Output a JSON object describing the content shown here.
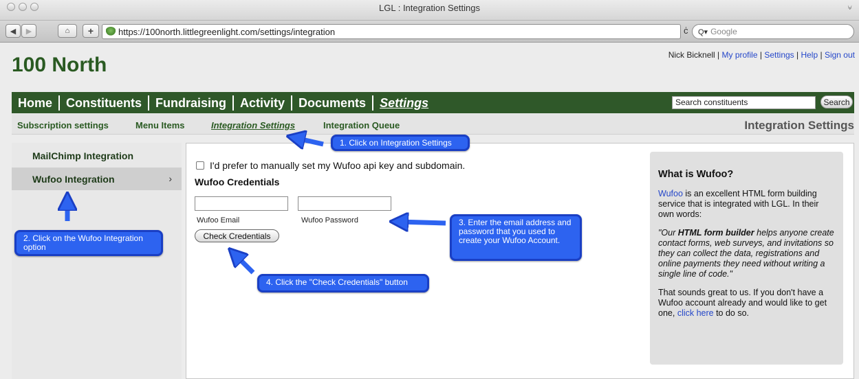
{
  "window": {
    "title": "LGL : Integration Settings"
  },
  "toolbar": {
    "back_icon": "left-triangle",
    "forward_icon": "right-triangle",
    "home_icon": "house",
    "add_icon": "plus",
    "url": "https://100north.littlegreenlight.com/settings/integration",
    "reload": "ċ",
    "search_placeholder": "Google",
    "search_icon": "Q▾"
  },
  "header": {
    "brand": "100 North",
    "user_name": "Nick Bicknell",
    "links": [
      "My profile",
      "Settings",
      "Help",
      "Sign out"
    ]
  },
  "mainnav": {
    "items": [
      "Home",
      "Constituents",
      "Fundraising",
      "Activity",
      "Documents",
      "Settings"
    ],
    "active": "Settings",
    "search_value": "Search constituents",
    "search_button": "Search"
  },
  "subnav": {
    "items": [
      "Subscription settings",
      "Menu Items",
      "Integration Settings",
      "Integration Queue"
    ],
    "active": "Integration Settings",
    "page_heading": "Integration Settings"
  },
  "sidebar": {
    "items": [
      "MailChimp Integration",
      "Wufoo Integration"
    ],
    "active": "Wufoo Integration",
    "chevron": "›"
  },
  "form": {
    "manual_checkbox_label": "I'd prefer to manually set my Wufoo api key and subdomain.",
    "manual_checked": false,
    "credentials_title": "Wufoo Credentials",
    "email_label": "Wufoo Email",
    "password_label": "Wufoo Password",
    "email_value": "",
    "password_value": "",
    "check_button": "Check Credentials"
  },
  "info": {
    "title": "What is Wufoo?",
    "p1_link": "Wufoo",
    "p1_text": " is an excellent HTML form building service that is integrated with LGL. In their own words:",
    "quote_pre": "\"Our ",
    "quote_bold": "HTML form builder",
    "quote_post": " helps anyone create contact forms, web surveys, and invitations so they can collect the data, registrations and online payments they need without writing a single line of code.\"",
    "p3_text": "That sounds great to us. If you don't have a Wufoo account already and would like to get one, ",
    "p3_link": "click here",
    "p3_end": " to do so."
  },
  "callouts": [
    "1. Click on Integration Settings",
    "2. Click on the Wufoo Integration option",
    "3. Enter the email address and password that you used to create your Wufoo Account.",
    "4. Click the \"Check Credentials\" button"
  ],
  "colors": {
    "brand_green": "#2f5829",
    "callout_blue": "#2d63f0",
    "link_blue": "#2547c9"
  }
}
